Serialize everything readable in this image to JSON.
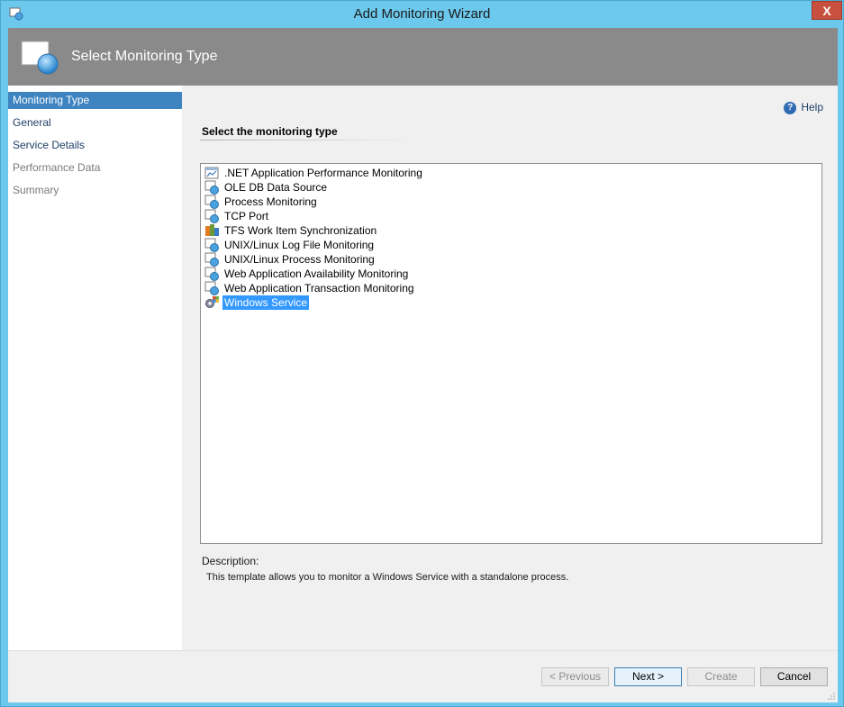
{
  "window": {
    "title": "Add Monitoring Wizard",
    "close_label": "X"
  },
  "header": {
    "title": "Select Monitoring Type"
  },
  "nav": {
    "items": [
      {
        "label": "Monitoring Type",
        "state": "selected"
      },
      {
        "label": "General",
        "state": "active"
      },
      {
        "label": "Service Details",
        "state": "active"
      },
      {
        "label": "Performance Data",
        "state": "disabled"
      },
      {
        "label": "Summary",
        "state": "disabled"
      }
    ]
  },
  "help": {
    "label": "Help",
    "icon": "help-question-icon"
  },
  "section": {
    "title": "Select the monitoring type"
  },
  "types": [
    {
      "label": ".NET Application Performance Monitoring",
      "icon": "dotnet-monitor-icon"
    },
    {
      "label": "OLE DB Data Source",
      "icon": "template-globe-icon"
    },
    {
      "label": "Process Monitoring",
      "icon": "template-globe-icon"
    },
    {
      "label": "TCP Port",
      "icon": "template-globe-icon"
    },
    {
      "label": "TFS Work Item Synchronization",
      "icon": "tfs-sync-icon"
    },
    {
      "label": "UNIX/Linux Log File Monitoring",
      "icon": "template-globe-icon"
    },
    {
      "label": "UNIX/Linux Process Monitoring",
      "icon": "template-globe-icon"
    },
    {
      "label": "Web Application Availability Monitoring",
      "icon": "template-globe-icon"
    },
    {
      "label": "Web Application Transaction Monitoring",
      "icon": "template-globe-icon"
    },
    {
      "label": "Windows Service",
      "icon": "windows-service-gear-icon",
      "selected": true
    }
  ],
  "description": {
    "label": "Description:",
    "text": "This template allows you to monitor a Windows Service with a standalone process."
  },
  "buttons": {
    "previous": "< Previous",
    "next": "Next >",
    "create": "Create",
    "cancel": "Cancel"
  },
  "colors": {
    "titlebar": "#6cc8ec",
    "header": "#8a8a8a",
    "nav_selected": "#3e84c1",
    "list_selected": "#3399ff",
    "close": "#c7503e"
  }
}
